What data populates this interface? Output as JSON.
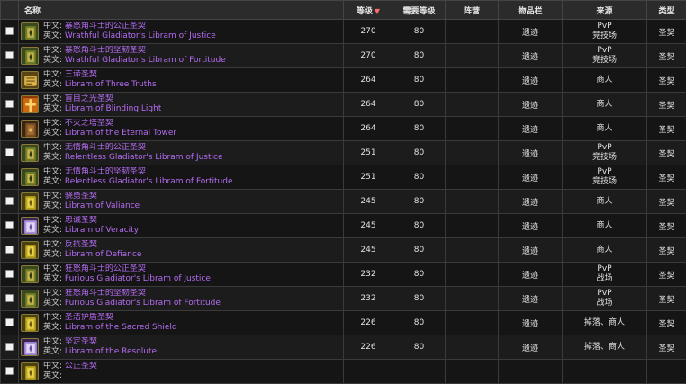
{
  "columns": {
    "name": "名称",
    "ilvl": "等级",
    "sort_arrow": "▼",
    "req_level": "需要等级",
    "faction": "阵营",
    "slot": "物品栏",
    "source": "来源",
    "type": "类型"
  },
  "label_cn": "中文:",
  "label_en": "英文:",
  "rows": [
    {
      "icon": "green-gold-libram-icon",
      "cn": "暴怒角斗士的公正圣契",
      "en": "Wrathful Gladiator's Libram of Justice",
      "ilvl": "270",
      "req": "80",
      "slot": "遗迹",
      "src1": "PvP",
      "src2": "竞技场",
      "type": "圣契"
    },
    {
      "icon": "green-gold-libram-icon",
      "cn": "暴怒角斗士的坚韧圣契",
      "en": "Wrathful Gladiator's Libram of Fortitude",
      "ilvl": "270",
      "req": "80",
      "slot": "遗迹",
      "src1": "PvP",
      "src2": "竞技场",
      "type": "圣契"
    },
    {
      "icon": "golden-scroll-icon",
      "cn": "三谛圣契",
      "en": "Libram of Three Truths",
      "ilvl": "264",
      "req": "80",
      "slot": "遗迹",
      "src1": "商人",
      "src2": "",
      "type": "圣契"
    },
    {
      "icon": "orange-cross-icon",
      "cn": "盲目之光圣契",
      "en": "Libram of Blinding Light",
      "ilvl": "264",
      "req": "80",
      "slot": "遗迹",
      "src1": "商人",
      "src2": "",
      "type": "圣契"
    },
    {
      "icon": "brown-tome-icon",
      "cn": "不灭之塔圣契",
      "en": "Libram of the Eternal Tower",
      "ilvl": "264",
      "req": "80",
      "slot": "遗迹",
      "src1": "商人",
      "src2": "",
      "type": "圣契"
    },
    {
      "icon": "green-gold-libram-icon",
      "cn": "无情角斗士的公正圣契",
      "en": "Relentless Gladiator's Libram of Justice",
      "ilvl": "251",
      "req": "80",
      "slot": "遗迹",
      "src1": "PvP",
      "src2": "竞技场",
      "type": "圣契"
    },
    {
      "icon": "green-gold-libram-icon",
      "cn": "无情角斗士的坚韧圣契",
      "en": "Relentless Gladiator's Libram of Fortitude",
      "ilvl": "251",
      "req": "80",
      "slot": "遗迹",
      "src1": "PvP",
      "src2": "竞技场",
      "type": "圣契"
    },
    {
      "icon": "yellow-libram-icon",
      "cn": "骁勇圣契",
      "en": "Libram of Valiance",
      "ilvl": "245",
      "req": "80",
      "slot": "遗迹",
      "src1": "商人",
      "src2": "",
      "type": "圣契"
    },
    {
      "icon": "purple-libram-icon",
      "cn": "忠诚圣契",
      "en": "Libram of Veracity",
      "ilvl": "245",
      "req": "80",
      "slot": "遗迹",
      "src1": "商人",
      "src2": "",
      "type": "圣契"
    },
    {
      "icon": "yellow-libram-icon",
      "cn": "反抗圣契",
      "en": "Libram of Defiance",
      "ilvl": "245",
      "req": "80",
      "slot": "遗迹",
      "src1": "商人",
      "src2": "",
      "type": "圣契"
    },
    {
      "icon": "green-gold-libram-icon",
      "cn": "狂怒角斗士的公正圣契",
      "en": "Furious Gladiator's Libram of Justice",
      "ilvl": "232",
      "req": "80",
      "slot": "遗迹",
      "src1": "PvP",
      "src2": "战场",
      "type": "圣契"
    },
    {
      "icon": "green-gold-libram-icon",
      "cn": "狂怒角斗士的坚韧圣契",
      "en": "Furious Gladiator's Libram of Fortitude",
      "ilvl": "232",
      "req": "80",
      "slot": "遗迹",
      "src1": "PvP",
      "src2": "战场",
      "type": "圣契"
    },
    {
      "icon": "yellow-libram-icon",
      "cn": "圣洁护盾圣契",
      "en": "Libram of the Sacred Shield",
      "ilvl": "226",
      "req": "80",
      "slot": "遗迹",
      "src1": "掉落、商人",
      "src2": "",
      "type": "圣契"
    },
    {
      "icon": "purple-libram-icon",
      "cn": "坚定圣契",
      "en": "Libram of the Resolute",
      "ilvl": "226",
      "req": "80",
      "slot": "遗迹",
      "src1": "掉落、商人",
      "src2": "",
      "type": "圣契"
    },
    {
      "icon": "yellow-libram-icon",
      "cn": "公正圣契",
      "en": "",
      "ilvl": "",
      "req": "",
      "slot": "",
      "src1": "",
      "src2": "",
      "type": ""
    }
  ]
}
